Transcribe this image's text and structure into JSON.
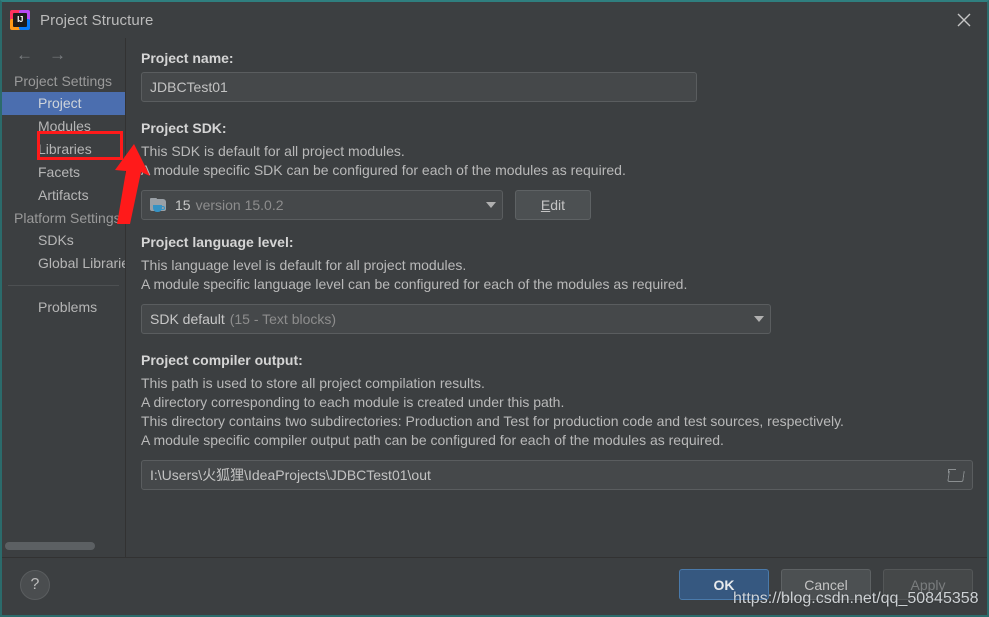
{
  "window": {
    "title": "Project Structure",
    "logo_icon": "intellij-idea-logo",
    "close_icon": "close-icon"
  },
  "sidebar": {
    "back_icon": "arrow-left-icon",
    "forward_icon": "arrow-right-icon",
    "back_glyph": "←",
    "forward_glyph": "→",
    "entries": [
      {
        "label": "Project Settings",
        "type": "group"
      },
      {
        "label": "Project",
        "type": "item",
        "selected": true
      },
      {
        "label": "Modules",
        "type": "item",
        "selected": false
      },
      {
        "label": "Libraries",
        "type": "item",
        "selected": false
      },
      {
        "label": "Facets",
        "type": "item",
        "selected": false
      },
      {
        "label": "Artifacts",
        "type": "item",
        "selected": false
      },
      {
        "label": "Platform Settings",
        "type": "group"
      },
      {
        "label": "SDKs",
        "type": "item",
        "selected": false
      },
      {
        "label": "Global Libraries",
        "type": "item",
        "selected": false
      },
      {
        "label": "",
        "type": "separator"
      },
      {
        "label": "Problems",
        "type": "item",
        "selected": false
      }
    ]
  },
  "main": {
    "project_name": {
      "label": "Project name:",
      "value": "JDBCTest01"
    },
    "project_sdk": {
      "label": "Project SDK:",
      "desc1": "This SDK is default for all project modules.",
      "desc2": "A module specific SDK can be configured for each of the modules as required.",
      "icon": "java-sdk-folder-icon",
      "value_main": "15",
      "value_dim": "version 15.0.2",
      "dropdown_icon": "chevron-down-icon",
      "edit_button": "Edit",
      "edit_mnemonic": "E",
      "edit_rest": "dit"
    },
    "language_level": {
      "label": "Project language level:",
      "desc1": "This language level is default for all project modules.",
      "desc2": "A module specific language level can be configured for each of the modules as required.",
      "value_main": "SDK default",
      "value_dim": "(15 - Text blocks)",
      "dropdown_icon": "chevron-down-icon"
    },
    "compiler_output": {
      "label": "Project compiler output:",
      "desc1": "This path is used to store all project compilation results.",
      "desc2": "A directory corresponding to each module is created under this path.",
      "desc3": "This directory contains two subdirectories: Production and Test for production code and test sources, respectively.",
      "desc4": "A module specific compiler output path can be configured for each of the modules as required.",
      "value": "I:\\Users\\火狐狸\\IdeaProjects\\JDBCTest01\\out",
      "browse_icon": "folder-browse-icon"
    }
  },
  "footer": {
    "help_label": "?",
    "help_icon": "help-icon",
    "ok": "OK",
    "cancel": "Cancel",
    "apply": "Apply"
  },
  "annotations": {
    "highlight_target": "Modules",
    "watermark": "https://blog.csdn.net/qq_50845358",
    "accent_red": "#ff1a1a"
  },
  "colors": {
    "selection_blue": "#4b6eaf",
    "primary_button": "#365880",
    "window_border": "#2b6b6b",
    "background": "#3c3f41"
  }
}
